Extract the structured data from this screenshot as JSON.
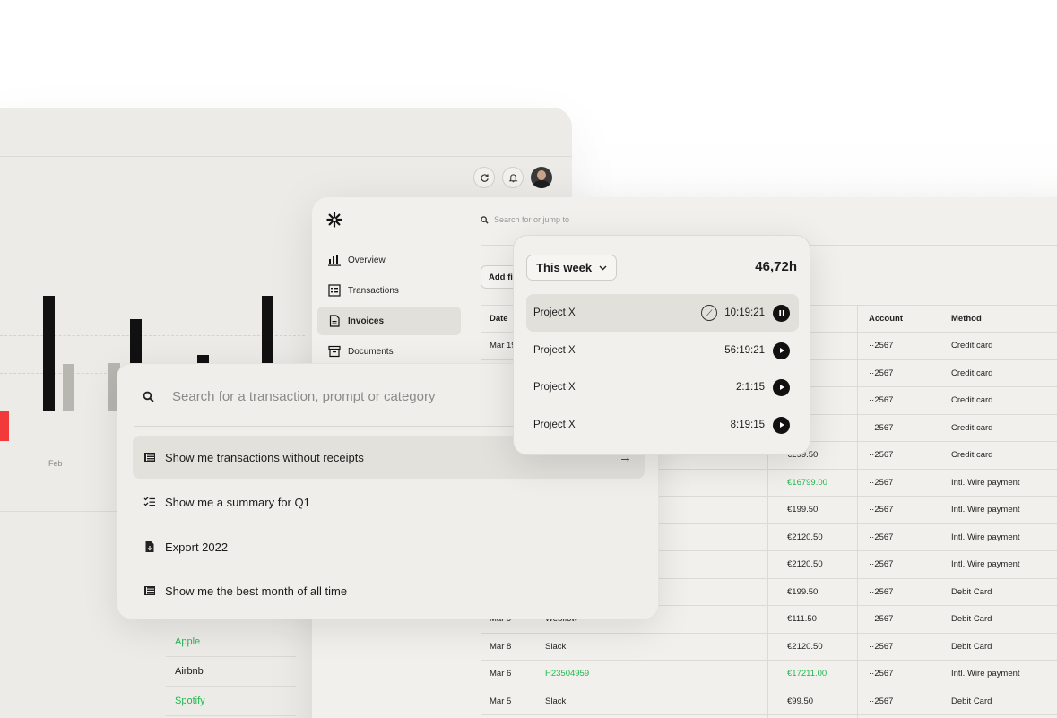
{
  "dashboard": {
    "month_label": "Feb",
    "bars": [
      {
        "h": 128,
        "color": "#111111"
      },
      {
        "h": 52,
        "color": "#b8b6b1"
      },
      {
        "h": 102,
        "color": "#111111"
      },
      {
        "h": 53,
        "color": "#b8b6b1"
      },
      {
        "h": 62,
        "color": "#111111"
      },
      {
        "h": 128,
        "color": "#111111"
      }
    ],
    "merchants": [
      {
        "name": "Apple",
        "green": true
      },
      {
        "name": "Airbnb",
        "green": false
      },
      {
        "name": "Spotify",
        "green": true
      }
    ]
  },
  "invoices_app": {
    "search_placeholder": "Search for or jump to",
    "nav": [
      {
        "label": "Overview",
        "icon": "bar-chart-icon",
        "active": false
      },
      {
        "label": "Transactions",
        "icon": "list-icon",
        "active": false
      },
      {
        "label": "Invoices",
        "icon": "file-icon",
        "active": true
      },
      {
        "label": "Documents",
        "icon": "archive-icon",
        "active": false
      }
    ],
    "add_filter_label": "Add fil",
    "table": {
      "headers": {
        "date": "Date",
        "name": "",
        "amount": "nt",
        "account": "Account",
        "method": "Method"
      },
      "rows": [
        {
          "date": "Mar 19",
          "name": "",
          "amount": ".50",
          "account": "··2567",
          "method": "Credit card",
          "green": false
        },
        {
          "date": "",
          "name": "",
          "amount": "0",
          "account": "··2567",
          "method": "Credit card",
          "green": false
        },
        {
          "date": "",
          "name": "",
          "amount": "50",
          "account": "··2567",
          "method": "Credit card",
          "green": false
        },
        {
          "date": "",
          "name": "",
          "amount": ".50",
          "account": "··2567",
          "method": "Credit card",
          "green": false
        },
        {
          "date": "",
          "name": "",
          "amount": "€299.50",
          "account": "··2567",
          "method": "Credit card",
          "green": false
        },
        {
          "date": "",
          "name": "",
          "amount": "€16799.00",
          "account": "··2567",
          "method": "Intl. Wire payment",
          "green": true
        },
        {
          "date": "",
          "name": "",
          "amount": "€199.50",
          "account": "··2567",
          "method": "Intl. Wire payment",
          "green": false
        },
        {
          "date": "",
          "name": "",
          "amount": "€2120.50",
          "account": "··2567",
          "method": "Intl. Wire payment",
          "green": false
        },
        {
          "date": "",
          "name": "",
          "amount": "€2120.50",
          "account": "··2567",
          "method": "Intl. Wire payment",
          "green": false
        },
        {
          "date": "",
          "name": "",
          "amount": "€199.50",
          "account": "··2567",
          "method": "Debit Card",
          "green": false
        },
        {
          "date": "Mar 9",
          "name": "Webflow",
          "amount": "€111.50",
          "account": "··2567",
          "method": "Debit Card",
          "green": false
        },
        {
          "date": "Mar 8",
          "name": "Slack",
          "amount": "€2120.50",
          "account": "··2567",
          "method": "Debit Card",
          "green": false
        },
        {
          "date": "Mar 6",
          "name": "H23504959",
          "amount": "€17211.00",
          "account": "··2567",
          "method": "Intl. Wire payment",
          "green": true
        },
        {
          "date": "Mar 5",
          "name": "Slack",
          "amount": "€99.50",
          "account": "··2567",
          "method": "Debit Card",
          "green": false
        }
      ]
    }
  },
  "palette": {
    "placeholder": "Search for a transaction, prompt or category",
    "items": [
      {
        "label": "Show me transactions without receipts",
        "icon": "table-icon",
        "active": true
      },
      {
        "label": "Show me a summary for Q1",
        "icon": "checklist-icon",
        "active": false
      },
      {
        "label": "Export 2022",
        "icon": "file-export-icon",
        "active": false
      },
      {
        "label": "Show me the best month of all time",
        "icon": "table-icon",
        "active": false
      }
    ]
  },
  "tracker": {
    "period": "This week",
    "total": "46,72h",
    "entries": [
      {
        "project": "Project X",
        "time": "10:19:21",
        "state": "running"
      },
      {
        "project": "Project X",
        "time": "56:19:21",
        "state": "stopped"
      },
      {
        "project": "Project X",
        "time": "2:1:15",
        "state": "stopped"
      },
      {
        "project": "Project X",
        "time": "8:19:15",
        "state": "stopped"
      }
    ]
  }
}
